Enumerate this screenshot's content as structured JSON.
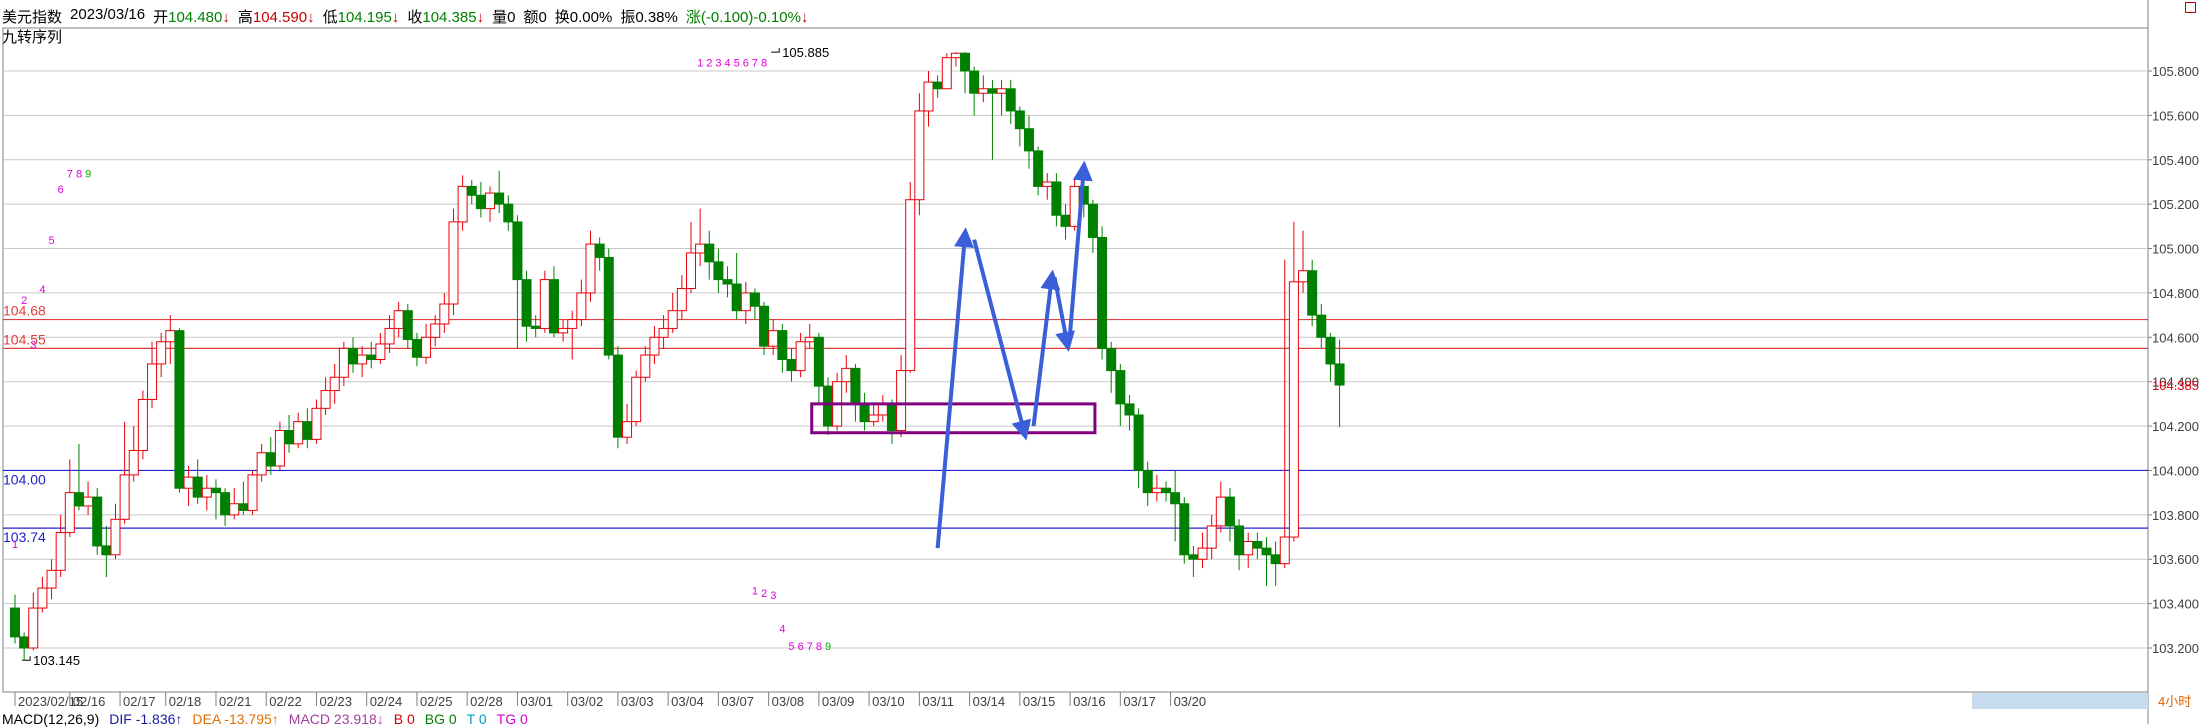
{
  "header": {
    "name": "美元指数",
    "date": "2023/03/16",
    "open_label": "开",
    "open": "104.480",
    "open_arrow": "↓",
    "high_label": "高",
    "high": "104.590",
    "high_arrow": "↓",
    "low_label": "低",
    "low": "104.195",
    "low_arrow": "↓",
    "close_label": "收",
    "close": "104.385",
    "close_arrow": "↓",
    "volume": "量0",
    "amount": "额0",
    "turnover": "换0.00%",
    "amplitude": "振0.38%",
    "change": "涨(-0.100)-0.10%",
    "change_arrow": "↓",
    "indicator": "九转序列"
  },
  "macd": {
    "params": "MACD(12,26,9)",
    "dif": "DIF -1.836↑",
    "dea": "DEA -13.795↑",
    "macd": "MACD 23.918↓",
    "b": "B 0",
    "bg": "BG 0",
    "t": "T 0",
    "tg": "TG 0"
  },
  "colors": {
    "up": "#e8000b",
    "down": "#008000",
    "grid": "#c8c8c8",
    "level_red": "#e04040",
    "level_blue": "#2020d0",
    "box": "#800080",
    "arrow": "#3a5fd8",
    "seq_magenta": "#e000e0",
    "seq_green": "#00b000"
  },
  "chart_data": {
    "type": "candlestick",
    "title": "美元指数",
    "period_label": "4小时",
    "ylim": [
      103.1,
      105.9
    ],
    "y_ticks": [
      "103.200",
      "103.400",
      "103.600",
      "103.800",
      "104.000",
      "104.200",
      "104.400",
      "104.600",
      "104.800",
      "105.000",
      "105.200",
      "105.400",
      "105.600",
      "105.800"
    ],
    "current_price": "104.385",
    "x_labels": [
      "2023/02/15",
      "02/16",
      "02/17",
      "02/18",
      "02/21",
      "02/22",
      "02/23",
      "02/24",
      "02/25",
      "02/28",
      "03/01",
      "03/02",
      "03/03",
      "03/04",
      "03/07",
      "03/08",
      "03/09",
      "03/10",
      "03/11",
      "03/14",
      "03/15",
      "03/16",
      "03/17",
      "03/20"
    ],
    "x_label_bars": [
      0,
      6,
      11.5,
      16.5,
      22,
      27.5,
      33,
      38.5,
      44,
      49.5,
      55,
      60.5,
      66,
      71.5,
      77,
      82.5,
      88,
      93.5,
      99,
      104.5,
      110,
      115.5,
      121,
      126.5
    ],
    "highlight_labels": [
      22,
      23
    ],
    "levels": [
      {
        "value": 104.68,
        "label": "104.68",
        "color": "red"
      },
      {
        "value": 104.55,
        "label": "104.55",
        "color": "red"
      },
      {
        "value": 104.0,
        "label": "104.00",
        "color": "blue"
      },
      {
        "value": 103.74,
        "label": "103.74",
        "color": "blue"
      }
    ],
    "extremes": [
      {
        "label": "103.145",
        "price": 103.145,
        "bar": 1
      },
      {
        "label": "105.885",
        "price": 105.885,
        "bar": 83
      }
    ],
    "candles": [
      [
        103.38,
        103.25,
        103.44,
        103.22
      ],
      [
        103.25,
        103.2,
        103.27,
        103.145
      ],
      [
        103.2,
        103.38,
        103.45,
        103.19
      ],
      [
        103.38,
        103.47,
        103.52,
        103.36
      ],
      [
        103.47,
        103.55,
        103.6,
        103.42
      ],
      [
        103.55,
        103.72,
        103.8,
        103.52
      ],
      [
        103.72,
        103.9,
        104.05,
        103.7
      ],
      [
        103.9,
        103.84,
        104.12,
        103.82
      ],
      [
        103.84,
        103.88,
        103.95,
        103.8
      ],
      [
        103.88,
        103.66,
        103.92,
        103.62
      ],
      [
        103.66,
        103.62,
        103.75,
        103.52
      ],
      [
        103.62,
        103.78,
        103.85,
        103.6
      ],
      [
        103.78,
        103.98,
        104.22,
        103.76
      ],
      [
        103.98,
        104.09,
        104.2,
        103.95
      ],
      [
        104.09,
        104.32,
        104.36,
        104.05
      ],
      [
        104.32,
        104.48,
        104.58,
        104.28
      ],
      [
        104.48,
        104.58,
        104.62,
        104.42
      ],
      [
        104.58,
        104.63,
        104.7,
        104.48
      ],
      [
        104.63,
        103.92,
        104.64,
        103.9
      ],
      [
        103.92,
        103.97,
        104.02,
        103.84
      ],
      [
        103.97,
        103.88,
        104.05,
        103.85
      ],
      [
        103.88,
        103.92,
        103.98,
        103.82
      ],
      [
        103.92,
        103.9,
        103.96,
        103.78
      ],
      [
        103.9,
        103.8,
        103.92,
        103.75
      ],
      [
        103.8,
        103.85,
        103.92,
        103.78
      ],
      [
        103.85,
        103.82,
        103.95,
        103.8
      ],
      [
        103.82,
        103.98,
        104.0,
        103.8
      ],
      [
        103.98,
        104.08,
        104.12,
        103.95
      ],
      [
        104.08,
        104.02,
        104.15,
        103.98
      ],
      [
        104.02,
        104.18,
        104.22,
        104.0
      ],
      [
        104.18,
        104.12,
        104.25,
        104.08
      ],
      [
        104.12,
        104.22,
        104.26,
        104.1
      ],
      [
        104.22,
        104.14,
        104.28,
        104.1
      ],
      [
        104.14,
        104.28,
        104.32,
        104.12
      ],
      [
        104.28,
        104.36,
        104.42,
        104.25
      ],
      [
        104.36,
        104.42,
        104.48,
        104.3
      ],
      [
        104.42,
        104.55,
        104.58,
        104.38
      ],
      [
        104.55,
        104.48,
        104.6,
        104.44
      ],
      [
        104.48,
        104.52,
        104.56,
        104.42
      ],
      [
        104.52,
        104.5,
        104.58,
        104.46
      ],
      [
        104.5,
        104.57,
        104.62,
        104.48
      ],
      [
        104.57,
        104.64,
        104.7,
        104.53
      ],
      [
        104.64,
        104.72,
        104.76,
        104.6
      ],
      [
        104.72,
        104.59,
        104.75,
        104.55
      ],
      [
        104.59,
        104.51,
        104.62,
        104.47
      ],
      [
        104.51,
        104.6,
        104.66,
        104.48
      ],
      [
        104.6,
        104.66,
        104.7,
        104.56
      ],
      [
        104.66,
        104.75,
        104.8,
        104.62
      ],
      [
        104.75,
        105.12,
        105.18,
        104.7
      ],
      [
        105.12,
        105.28,
        105.33,
        105.08
      ],
      [
        105.28,
        105.24,
        105.31,
        105.2
      ],
      [
        105.24,
        105.18,
        105.3,
        105.14
      ],
      [
        105.18,
        105.25,
        105.28,
        105.12
      ],
      [
        105.25,
        105.2,
        105.35,
        105.16
      ],
      [
        105.2,
        105.12,
        105.24,
        105.08
      ],
      [
        105.12,
        104.86,
        105.15,
        104.55
      ],
      [
        104.86,
        104.65,
        104.9,
        104.58
      ],
      [
        104.65,
        104.64,
        104.7,
        104.6
      ],
      [
        104.64,
        104.86,
        104.9,
        104.62
      ],
      [
        104.86,
        104.62,
        104.92,
        104.6
      ],
      [
        104.62,
        104.64,
        104.68,
        104.58
      ],
      [
        104.64,
        104.68,
        104.72,
        104.5
      ],
      [
        104.68,
        104.8,
        104.86,
        104.65
      ],
      [
        104.8,
        105.02,
        105.08,
        104.76
      ],
      [
        105.02,
        104.96,
        105.05,
        104.9
      ],
      [
        104.96,
        104.52,
        105.0,
        104.5
      ],
      [
        104.52,
        104.15,
        104.56,
        104.1
      ],
      [
        104.15,
        104.22,
        104.3,
        104.12
      ],
      [
        104.22,
        104.42,
        104.45,
        104.2
      ],
      [
        104.42,
        104.52,
        104.56,
        104.4
      ],
      [
        104.52,
        104.6,
        104.65,
        104.48
      ],
      [
        104.6,
        104.64,
        104.7,
        104.55
      ],
      [
        104.64,
        104.72,
        104.8,
        104.62
      ],
      [
        104.72,
        104.82,
        104.88,
        104.68
      ],
      [
        104.82,
        104.98,
        105.12,
        104.8
      ],
      [
        104.98,
        105.02,
        105.18,
        104.92
      ],
      [
        105.02,
        104.94,
        105.08,
        104.86
      ],
      [
        104.94,
        104.86,
        105.0,
        104.8
      ],
      [
        104.86,
        104.84,
        104.92,
        104.78
      ],
      [
        104.84,
        104.72,
        104.98,
        104.68
      ],
      [
        104.72,
        104.8,
        104.85,
        104.66
      ],
      [
        104.8,
        104.74,
        104.82,
        104.68
      ],
      [
        104.74,
        104.56,
        104.76,
        104.52
      ],
      [
        104.56,
        104.63,
        104.68,
        104.52
      ],
      [
        104.63,
        104.5,
        104.66,
        104.44
      ],
      [
        104.5,
        104.45,
        104.55,
        104.4
      ],
      [
        104.45,
        104.58,
        104.62,
        104.42
      ],
      [
        104.58,
        104.6,
        104.66,
        104.55
      ],
      [
        104.6,
        104.38,
        104.62,
        104.3
      ],
      [
        104.38,
        104.2,
        104.42,
        104.16
      ],
      [
        104.2,
        104.4,
        104.44,
        104.18
      ],
      [
        104.4,
        104.46,
        104.52,
        104.35
      ],
      [
        104.46,
        104.3,
        104.48,
        104.22
      ],
      [
        104.3,
        104.22,
        104.35,
        104.18
      ],
      [
        104.22,
        104.25,
        104.3,
        104.2
      ],
      [
        104.25,
        104.3,
        104.34,
        104.22
      ],
      [
        104.3,
        104.18,
        104.32,
        104.12
      ],
      [
        104.18,
        104.45,
        104.52,
        104.15
      ],
      [
        104.45,
        105.22,
        105.3,
        104.44
      ],
      [
        105.22,
        105.62,
        105.7,
        105.15
      ],
      [
        105.62,
        105.75,
        105.8,
        105.55
      ],
      [
        105.75,
        105.72,
        105.78,
        105.68
      ],
      [
        105.72,
        105.86,
        105.88,
        105.8
      ],
      [
        105.86,
        105.88,
        105.885,
        105.82
      ],
      [
        105.88,
        105.8,
        105.885,
        105.7
      ],
      [
        105.8,
        105.7,
        105.82,
        105.6
      ],
      [
        105.7,
        105.72,
        105.78,
        105.66
      ],
      [
        105.72,
        105.7,
        105.76,
        105.4
      ],
      [
        105.7,
        105.72,
        105.76,
        105.6
      ],
      [
        105.72,
        105.62,
        105.76,
        105.56
      ],
      [
        105.62,
        105.54,
        105.64,
        105.46
      ],
      [
        105.54,
        105.44,
        105.6,
        105.36
      ],
      [
        105.44,
        105.28,
        105.46,
        105.24
      ],
      [
        105.28,
        105.3,
        105.34,
        105.22
      ],
      [
        105.3,
        105.15,
        105.34,
        105.1
      ],
      [
        105.15,
        105.1,
        105.2,
        105.04
      ],
      [
        105.1,
        105.28,
        105.32,
        105.08
      ],
      [
        105.28,
        105.2,
        105.32,
        105.14
      ],
      [
        105.2,
        105.05,
        105.22,
        104.98
      ],
      [
        105.05,
        104.55,
        105.1,
        104.5
      ],
      [
        104.55,
        104.45,
        104.58,
        104.35
      ],
      [
        104.45,
        104.3,
        104.48,
        104.2
      ],
      [
        104.3,
        104.25,
        104.34,
        104.18
      ],
      [
        104.25,
        104.0,
        104.28,
        103.92
      ],
      [
        104.0,
        103.9,
        104.04,
        103.84
      ],
      [
        103.9,
        103.92,
        103.98,
        103.86
      ],
      [
        103.92,
        103.9,
        103.95,
        103.86
      ],
      [
        103.9,
        103.85,
        104.0,
        103.68
      ],
      [
        103.85,
        103.62,
        103.88,
        103.58
      ],
      [
        103.62,
        103.6,
        103.66,
        103.52
      ],
      [
        103.6,
        103.65,
        103.72,
        103.56
      ],
      [
        103.65,
        103.75,
        103.8,
        103.6
      ],
      [
        103.75,
        103.88,
        103.95,
        103.72
      ],
      [
        103.88,
        103.75,
        103.92,
        103.68
      ],
      [
        103.75,
        103.62,
        103.78,
        103.55
      ],
      [
        103.62,
        103.68,
        103.72,
        103.56
      ],
      [
        103.68,
        103.65,
        103.72,
        103.6
      ],
      [
        103.65,
        103.62,
        103.7,
        103.48
      ],
      [
        103.62,
        103.58,
        103.68,
        103.48
      ],
      [
        103.58,
        103.7,
        104.95,
        103.56
      ],
      [
        103.7,
        104.85,
        105.12,
        103.68
      ],
      [
        104.85,
        104.9,
        105.08,
        104.8
      ],
      [
        104.9,
        104.7,
        104.95,
        104.65
      ],
      [
        104.7,
        104.6,
        104.75,
        104.55
      ],
      [
        104.6,
        104.48,
        104.62,
        104.4
      ],
      [
        104.48,
        104.385,
        104.59,
        104.195
      ]
    ],
    "td_sequences": [
      {
        "label": "1",
        "bar": 0,
        "price": 103.65,
        "color": "magenta"
      },
      {
        "label": "2",
        "bar": 1,
        "price": 104.75,
        "color": "magenta"
      },
      {
        "label": "3",
        "bar": 2,
        "price": 104.55,
        "color": "magenta"
      },
      {
        "label": "4",
        "bar": 3,
        "price": 104.8,
        "color": "magenta"
      },
      {
        "label": "5",
        "bar": 4,
        "price": 105.02,
        "color": "magenta"
      },
      {
        "label": "6",
        "bar": 5,
        "price": 105.25,
        "color": "magenta"
      },
      {
        "label": "7",
        "bar": 6,
        "price": 105.32,
        "color": "magenta"
      },
      {
        "label": "8",
        "bar": 7,
        "price": 105.32,
        "color": "magenta"
      },
      {
        "label": "9",
        "bar": 8,
        "price": 105.32,
        "color": "green"
      },
      {
        "label": "1",
        "bar": 75,
        "price": 105.82,
        "color": "magenta"
      },
      {
        "label": "2",
        "bar": 76,
        "price": 105.82,
        "color": "magenta"
      },
      {
        "label": "3",
        "bar": 77,
        "price": 105.82,
        "color": "magenta"
      },
      {
        "label": "4",
        "bar": 78,
        "price": 105.82,
        "color": "magenta"
      },
      {
        "label": "5",
        "bar": 79,
        "price": 105.82,
        "color": "magenta"
      },
      {
        "label": "6",
        "bar": 80,
        "price": 105.82,
        "color": "magenta"
      },
      {
        "label": "7",
        "bar": 81,
        "price": 105.82,
        "color": "magenta"
      },
      {
        "label": "8",
        "bar": 82,
        "price": 105.82,
        "color": "magenta"
      },
      {
        "label": "1",
        "bar": 81,
        "price": 103.44,
        "color": "magenta"
      },
      {
        "label": "2",
        "bar": 82,
        "price": 103.43,
        "color": "magenta"
      },
      {
        "label": "3",
        "bar": 83,
        "price": 103.42,
        "color": "magenta"
      },
      {
        "label": "4",
        "bar": 84,
        "price": 103.27,
        "color": "magenta"
      },
      {
        "label": "5",
        "bar": 85,
        "price": 103.19,
        "color": "magenta"
      },
      {
        "label": "6",
        "bar": 86,
        "price": 103.19,
        "color": "magenta"
      },
      {
        "label": "7",
        "bar": 87,
        "price": 103.19,
        "color": "magenta"
      },
      {
        "label": "8",
        "bar": 88,
        "price": 103.19,
        "color": "magenta"
      },
      {
        "label": "9",
        "bar": 89,
        "price": 103.19,
        "color": "green"
      }
    ],
    "zone_box": {
      "bar_start": 87,
      "bar_end": 118,
      "price_low": 104.17,
      "price_high": 104.3
    },
    "forecast_arrows": [
      {
        "from": [
          101,
          103.65
        ],
        "to": [
          104,
          105.06
        ]
      },
      {
        "from": [
          105,
          105.04
        ],
        "to": [
          110.5,
          104.17
        ]
      },
      {
        "from": [
          111.5,
          104.2
        ],
        "to": [
          113.5,
          104.87
        ]
      },
      {
        "from": [
          113.8,
          104.87
        ],
        "to": [
          115.2,
          104.57
        ]
      },
      {
        "from": [
          115.4,
          104.57
        ],
        "to": [
          117,
          105.36
        ]
      }
    ]
  }
}
